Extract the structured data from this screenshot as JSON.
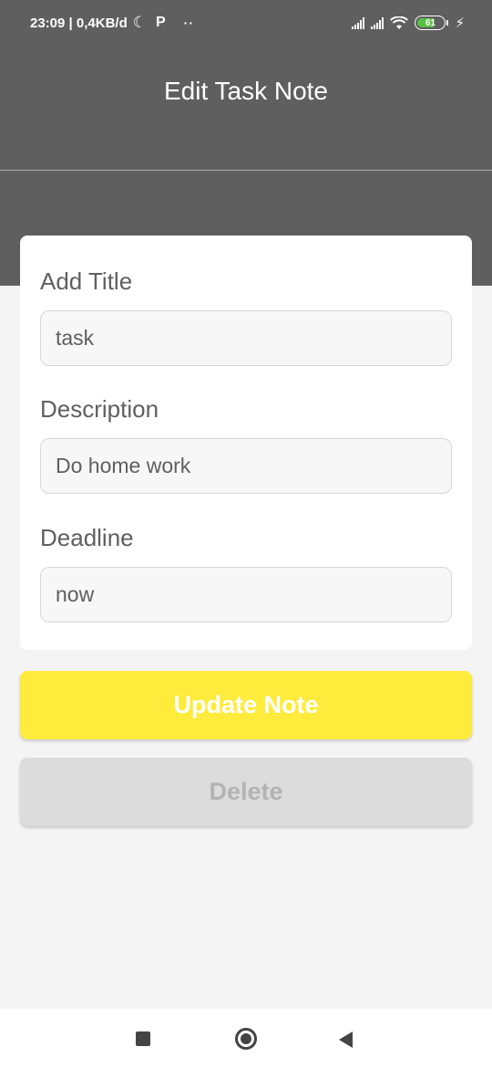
{
  "status_bar": {
    "time_info": "23:09 | 0,4KB/d",
    "moon_icon": "moon-icon",
    "p_label": "P",
    "dots": "··",
    "battery_level": "61",
    "bolt": "⚡"
  },
  "header": {
    "title": "Edit Task Note"
  },
  "form": {
    "title_label": "Add Title",
    "title_value": "task",
    "description_label": "Description",
    "description_value": "Do home work",
    "deadline_label": "Deadline",
    "deadline_value": "now"
  },
  "buttons": {
    "update_label": "Update Note",
    "delete_label": "Delete"
  },
  "colors": {
    "header_bg": "#5f5f5f",
    "update_button": "#ffeb3b",
    "delete_button": "#dcdcdc",
    "page_bg": "#f4f4f4"
  }
}
